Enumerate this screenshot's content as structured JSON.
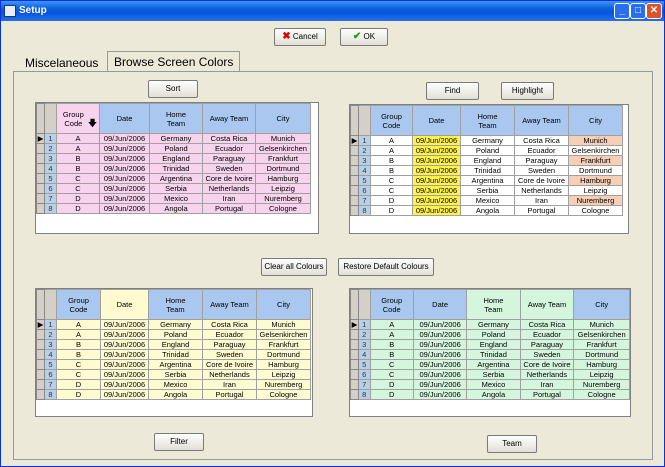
{
  "window": {
    "title": "Setup"
  },
  "buttons": {
    "cancel": "Cancel",
    "ok": "OK",
    "sort": "Sort",
    "find": "Find",
    "highlight": "Highlight",
    "clear_all": "Clear all Colours",
    "restore": "Restore Default Colours",
    "filter": "Filter",
    "team": "Team"
  },
  "tabs": {
    "misc": "Miscelaneous",
    "browse": "Browse Screen Colors"
  },
  "columns": [
    "Group Code",
    "Date",
    "Home Team",
    "Away Team",
    "City"
  ],
  "rows": [
    [
      "1",
      "A",
      "09/Jun/2006",
      "Germany",
      "Costa Rica",
      "Munich"
    ],
    [
      "2",
      "A",
      "09/Jun/2006",
      "Poland",
      "Ecuador",
      "Gelsenkirchen"
    ],
    [
      "3",
      "B",
      "09/Jun/2006",
      "England",
      "Paraguay",
      "Frankfurt"
    ],
    [
      "4",
      "B",
      "09/Jun/2006",
      "Trinidad",
      "Sweden",
      "Dortmund"
    ],
    [
      "5",
      "C",
      "09/Jun/2006",
      "Argentina",
      "Core de Ivoire",
      "Hamburg"
    ],
    [
      "6",
      "C",
      "09/Jun/2006",
      "Serbia",
      "Netherlands",
      "Leipzig"
    ],
    [
      "7",
      "D",
      "09/Jun/2006",
      "Mexico",
      "Iran",
      "Nuremberg"
    ],
    [
      "8",
      "D",
      "09/Jun/2006",
      "Angola",
      "Portugal",
      "Cologne"
    ]
  ],
  "colors": {
    "sort": "#f7d3ee",
    "filter": "#fffbd0",
    "team": "#d4f6dd",
    "find_date": "#fff24a",
    "find_city": "#f6cfb6",
    "header": "#a9c7ef"
  }
}
